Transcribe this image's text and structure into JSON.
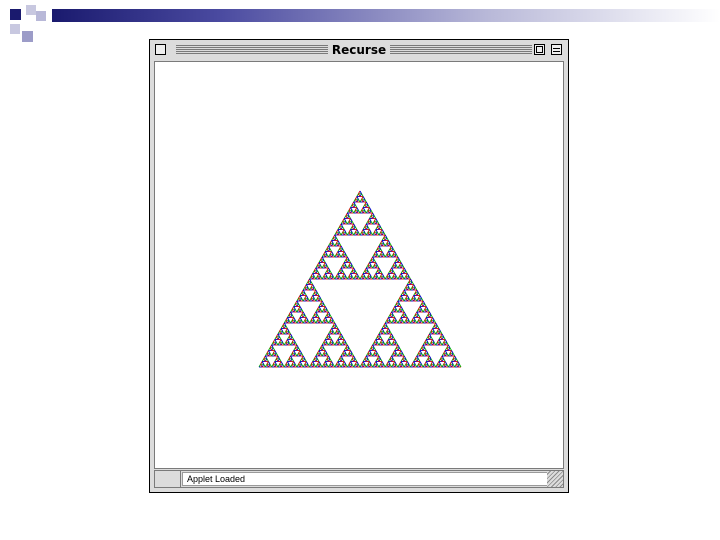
{
  "window": {
    "title": "Recurse",
    "status_text": "Applet Loaded"
  },
  "fractal": {
    "type": "sierpinski-triangle",
    "depth": 6,
    "colors": [
      "#e00000",
      "#00b000",
      "#0000c8"
    ]
  },
  "colors": {
    "slide_dark": "#1a1a6e",
    "slide_light": "#b8b8d8",
    "window_chrome": "#dcdcdc"
  }
}
